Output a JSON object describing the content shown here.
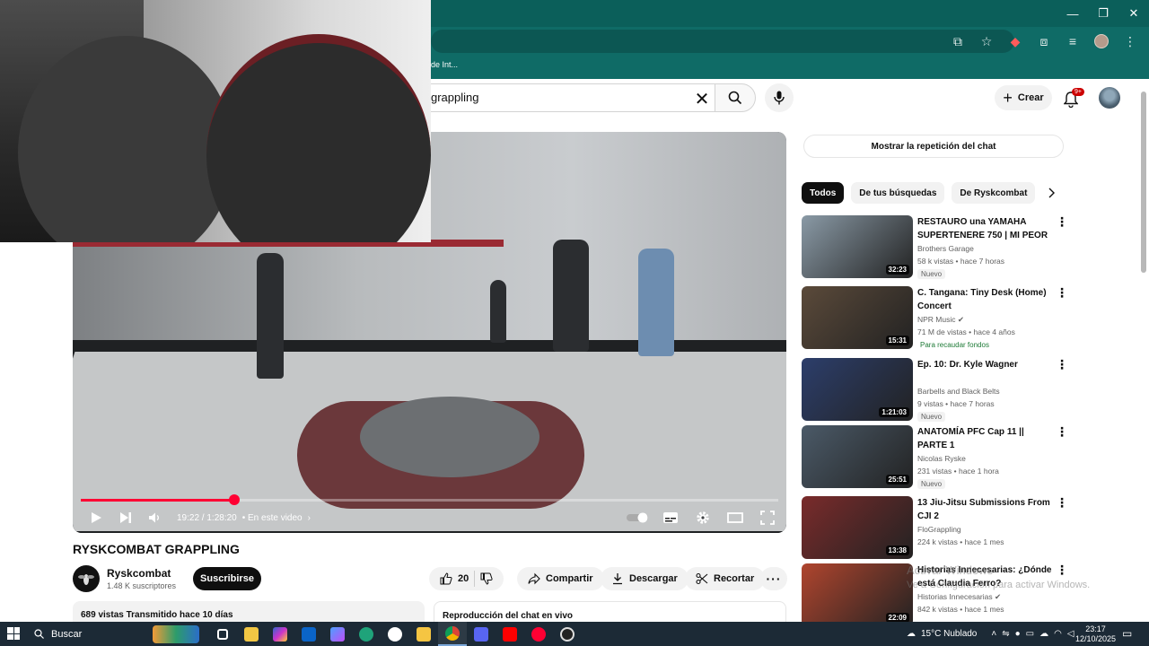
{
  "browser": {
    "bookmark_label": "de Int...",
    "window_controls": [
      "—",
      "❐",
      "✕"
    ]
  },
  "youtube": {
    "search_query": "grappling",
    "create_label": "Crear",
    "notifications": "9+"
  },
  "player": {
    "progress": 0.22,
    "time": "19:22 / 1:28:20",
    "chapter": "• En este video"
  },
  "video": {
    "title": "RYSKCOMBAT GRAPPLING",
    "channel": "Ryskcombat",
    "subscribers": "1.48 K suscriptores",
    "subscribe_label": "Suscribirse",
    "likes": "20",
    "share_label": "Compartir",
    "download_label": "Descargar",
    "clip_label": "Recortar",
    "info": "689 vistas  Transmitido hace 10 días",
    "chat_label": "Reproducción del chat en vivo"
  },
  "sidebar": {
    "chat_replay": "Mostrar la repetición del chat",
    "chips": [
      "Todos",
      "De tus búsquedas",
      "De Ryskcombat"
    ],
    "recommendations": [
      {
        "title": "RESTAURO una YAMAHA SUPERTENERE 750 | MI PEOR ...",
        "channel": "Brothers Garage",
        "meta": "58 k vistas • hace 7 horas",
        "badge": "Nuevo",
        "duration": "32:23",
        "thumb_color": "#8a9aa6",
        "verified": false
      },
      {
        "title": "C. Tangana: Tiny Desk (Home) Concert",
        "channel": "NPR Music",
        "meta": "71 M de vistas • hace 4 años",
        "badge": "Para recaudar fondos",
        "duration": "15:31",
        "thumb_color": "#5b4a3a",
        "verified": true
      },
      {
        "title": "Ep. 10: Dr. Kyle Wagner",
        "channel": "Barbells and Black Belts",
        "meta": "9 vistas • hace 7 horas",
        "badge": "Nuevo",
        "duration": "1:21:03",
        "thumb_color": "#2c3e6b",
        "verified": false
      },
      {
        "title": "ANATOMÍA PFC Cap 11 || PARTE 1",
        "channel": "Nicolas Ryske",
        "meta": "231 vistas • hace 1 hora",
        "badge": "Nuevo",
        "duration": "25:51",
        "thumb_color": "#4b5a68",
        "verified": false
      },
      {
        "title": "13 Jiu-Jitsu Submissions From CJI 2",
        "channel": "FloGrappling",
        "meta": "224 k vistas • hace 1 mes",
        "badge": "",
        "duration": "13:38",
        "thumb_color": "#7a2b2b",
        "verified": false
      },
      {
        "title": "Historias Innecesarias: ¿Dónde está Claudia Ferro?",
        "channel": "Historias Innecesarias",
        "meta": "842 k vistas • hace 1 mes",
        "badge": "",
        "duration": "22:09",
        "thumb_color": "#b0452e",
        "verified": true
      }
    ],
    "watermark_line1": "Activar Windows",
    "watermark_line2": "Ve a Configuración para activar Windows."
  },
  "taskbar": {
    "search_label": "Buscar",
    "weather": "15°C  Nublado",
    "time": "23:17",
    "date": "12/10/2025"
  }
}
